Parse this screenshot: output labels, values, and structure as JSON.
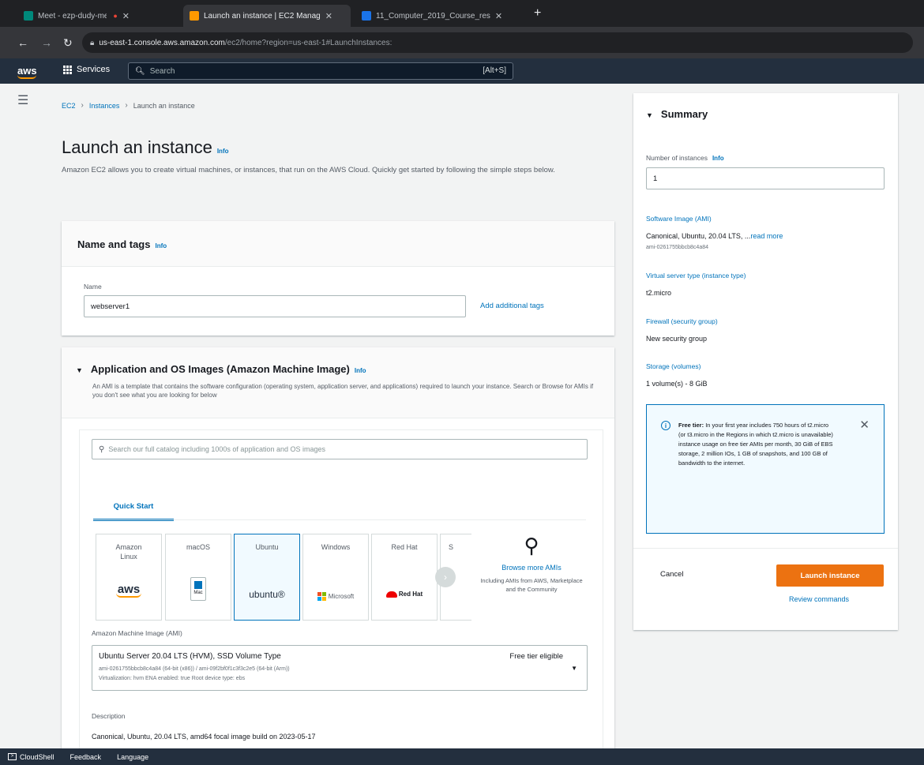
{
  "browser": {
    "tabs": [
      {
        "label": "Meet - ezp-dudy-mek",
        "active": false
      },
      {
        "label": "Launch an instance | EC2 Manag",
        "active": true
      },
      {
        "label": "11_Computer_2019_Course_res",
        "active": false
      }
    ],
    "url_host": "us-east-1.console.aws.amazon.com",
    "url_path": "/ec2/home?region=us-east-1#LaunchInstances:"
  },
  "awsnav": {
    "logo": "aws",
    "services_label": "Services",
    "search_placeholder": "Search",
    "search_shortcut": "[Alt+S]"
  },
  "breadcrumb": [
    "EC2",
    "Instances",
    "Launch an instance"
  ],
  "page": {
    "title": "Launch an instance",
    "info": "Info",
    "description": "Amazon EC2 allows you to create virtual machines, or instances, that run on the AWS Cloud. Quickly get started by following the simple steps below."
  },
  "name_tags": {
    "title": "Name and tags",
    "info": "Info",
    "name_label": "Name",
    "name_value": "webserver1",
    "add_tags": "Add additional tags"
  },
  "ami": {
    "title": "Application and OS Images (Amazon Machine Image)",
    "info": "Info",
    "description": "An AMI is a template that contains the software configuration (operating system, application server, and applications) required to launch your instance. Search or Browse for AMIs if you don't see what you are looking for below",
    "search_placeholder": "Search our full catalog including 1000s of application and OS images",
    "quick_start_tab": "Quick Start",
    "os_options": [
      {
        "name": "Amazon Linux",
        "logo": "aws"
      },
      {
        "name": "macOS",
        "logo": "Mac"
      },
      {
        "name": "Ubuntu",
        "logo": "ubuntu®"
      },
      {
        "name": "Windows",
        "logo": "Microsoft"
      },
      {
        "name": "Red Hat",
        "logo": "Red Hat"
      },
      {
        "name": "S",
        "logo": ""
      }
    ],
    "browse_title": "Browse more AMIs",
    "browse_desc": "Including AMIs from AWS, Marketplace and the Community",
    "ami_label": "Amazon Machine Image (AMI)",
    "selected_ami": {
      "name": "Ubuntu Server 20.04 LTS (HVM), SSD Volume Type",
      "badge": "Free tier eligible",
      "ids": "ami-0261755bbcb8c4a84 (64-bit (x86)) / ami-09f2bf0f1c3f3c2e5 (64-bit (Arm))",
      "details": "Virtualization: hvm    ENA enabled: true    Root device type: ebs"
    },
    "description_label": "Description",
    "description_value": "Canonical, Ubuntu, 20.04 LTS, amd64 focal image build on 2023-05-17"
  },
  "summary": {
    "title": "Summary",
    "num_instances_label": "Number of instances",
    "info": "Info",
    "num_instances_value": "1",
    "software_image_label": "Software Image (AMI)",
    "software_image_value": "Canonical, Ubuntu, 20.04 LTS, ...",
    "read_more": "read more",
    "software_image_id": "ami-0261755bbcb8c4a84",
    "instance_type_label": "Virtual server type (instance type)",
    "instance_type_value": "t2.micro",
    "firewall_label": "Firewall (security group)",
    "firewall_value": "New security group",
    "storage_label": "Storage (volumes)",
    "storage_value": "1 volume(s) - 8 GiB",
    "free_tier_bold": "Free tier:",
    "free_tier_text": "In your first year includes 750 hours of t2.micro (or t3.micro in the Regions in which t2.micro is unavailable) instance usage on free tier AMIs per month, 30 GiB of EBS storage, 2 million IOs, 1 GB of snapshots, and 100 GB of bandwidth to the internet.",
    "cancel": "Cancel",
    "launch": "Launch instance",
    "review": "Review commands"
  },
  "footer": {
    "cloudshell": "CloudShell",
    "feedback": "Feedback",
    "language": "Language"
  },
  "colors": {
    "aws_nav": "#232f3e",
    "link": "#0073bb",
    "primary_button": "#ec7211",
    "aws_orange": "#ff9900"
  }
}
